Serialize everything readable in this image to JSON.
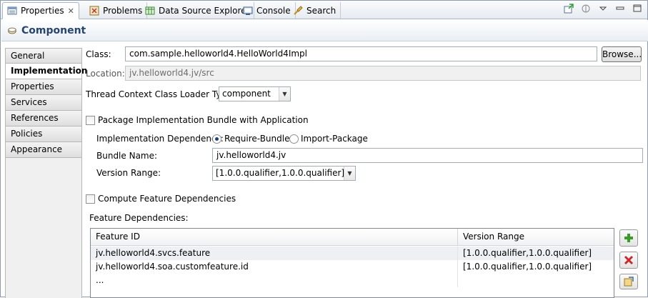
{
  "tabs": [
    {
      "label": "Properties",
      "icon": "properties-view-icon",
      "close": "✕"
    },
    {
      "label": "Problems",
      "icon": "problems-icon"
    },
    {
      "label": "Data Source Explorer",
      "icon": "data-source-icon"
    },
    {
      "label": "Console",
      "icon": "console-icon"
    },
    {
      "label": "Search",
      "icon": "search-icon"
    }
  ],
  "header": {
    "title": "Component",
    "icon": "component-icon"
  },
  "side_tabs": [
    "General",
    "Implementation",
    "Properties",
    "Services",
    "References",
    "Policies",
    "Appearance"
  ],
  "form": {
    "class_label": "Class:",
    "class_value": "com.sample.helloworld4.HelloWorld4Impl",
    "browse_label": "Browse...",
    "location_label": "Location:",
    "location_value": "jv.helloworld4.jv/src",
    "thread_label": "Thread Context Class Loader Type:",
    "thread_value": "component",
    "package_label": "Package Implementation Bundle with Application",
    "impl_dep_label": "Implementation Dependency:",
    "require_bundle_label": "Require-Bundle",
    "import_package_label": "Import-Package",
    "bundle_name_label": "Bundle Name:",
    "bundle_name_value": "jv.helloworld4.jv",
    "version_range_label": "Version Range:",
    "version_range_value": "[1.0.0.qualifier,1.0.0.qualifier]",
    "compute_label": "Compute Feature Dependencies",
    "feature_deps_label": "Feature Dependencies:"
  },
  "table": {
    "columns": [
      "Feature ID",
      "Version Range"
    ],
    "rows": [
      [
        "jv.helloworld4.svcs.feature",
        "[1.0.0.qualifier,1.0.0.qualifier]"
      ],
      [
        "jv.helloworld4.soa.customfeature.id",
        "[1.0.0.qualifier,1.0.0.qualifier]"
      ],
      [
        "...",
        ""
      ]
    ]
  },
  "colors": {
    "header_title": "#26456e",
    "add_green": "#3a9a2a",
    "remove_red": "#cc2a2a"
  }
}
